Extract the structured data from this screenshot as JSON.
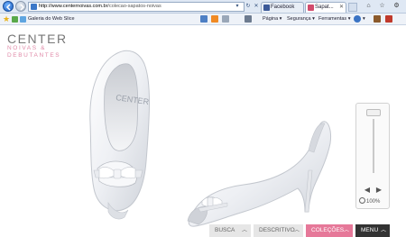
{
  "browser": {
    "url_host": "http://www.centernoivas.com.br",
    "url_rest": "/colecao-sapatos-noivas",
    "tabs": [
      {
        "label": "Facebook"
      },
      {
        "label": "Sapat..."
      }
    ],
    "favorites": {
      "gallery_label": "Galeria do Web Slice"
    },
    "commands": {
      "page_label": "Página",
      "security_label": "Segurança",
      "tools_label": "Ferramentas"
    }
  },
  "site": {
    "logo": {
      "main": "CENTER",
      "line1": "NOIVAS &",
      "line2": "DEBUTANTES"
    },
    "zoom": {
      "level": "100%"
    },
    "menu": {
      "busca": "BUSCA",
      "descritivo": "DESCRITIVO",
      "colecoes": "COLEÇÕES",
      "menu": "MENU"
    },
    "colors": {
      "accent_pink": "#e67899",
      "menu_dark": "#333333"
    },
    "icons": [
      "back-arrow-icon",
      "forward-arrow-icon",
      "close-icon",
      "zoom-magnifier-icon",
      "chevron-up-icon"
    ]
  }
}
